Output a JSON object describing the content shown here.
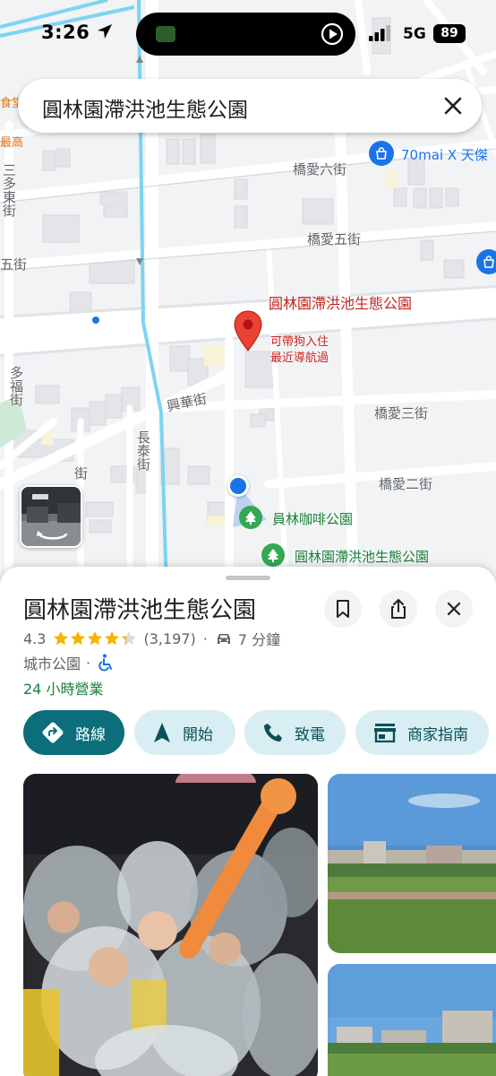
{
  "status_bar": {
    "time": "3:26",
    "network": "5G",
    "battery": "89"
  },
  "search": {
    "query": "圓林園滯洪池生態公園"
  },
  "map": {
    "streets": {
      "qiaoai6": "橋愛六街",
      "qiaoai5": "橋愛五街",
      "qiaoai3": "橋愛三街",
      "qiaoai2": "橋愛二街",
      "xinghua": "興華街",
      "changtai": "長泰街",
      "duofu": "多福街",
      "sanduodong": "三多東街",
      "wu_partial": "五街",
      "jie_partial": "街"
    },
    "orange_labels": [
      "食堂",
      "最高"
    ],
    "store_label": "70mai X 天傑",
    "selected_place": {
      "name": "圓林園滯洪池生態公園",
      "note1": "可帶狗入住",
      "note2": "最近導航過"
    },
    "nearby_parks": [
      "員林咖啡公園",
      "圓林園滯洪池生態公園"
    ],
    "colors": {
      "road": "#ffffff",
      "block": "#e8eaed",
      "water": "#7dd4f0",
      "pin": "#ea4335",
      "location": "#1a73e8",
      "park": "#34a853"
    }
  },
  "place": {
    "name": "圓林園滯洪池生態公園",
    "rating": "4.3",
    "rating_value": 4.3,
    "review_count": "(3,197)",
    "dot": "·",
    "drive_time": "7 分鐘",
    "category": "城市公園",
    "hours": "24 小時營業"
  },
  "actions": {
    "directions": "路線",
    "start": "開始",
    "call": "致電",
    "guide": "商家指南"
  },
  "icons": {
    "bookmark": "bookmark-icon",
    "share": "share-icon",
    "close": "close-icon",
    "car": "car-icon",
    "wheelchair": "wheelchair-icon"
  }
}
